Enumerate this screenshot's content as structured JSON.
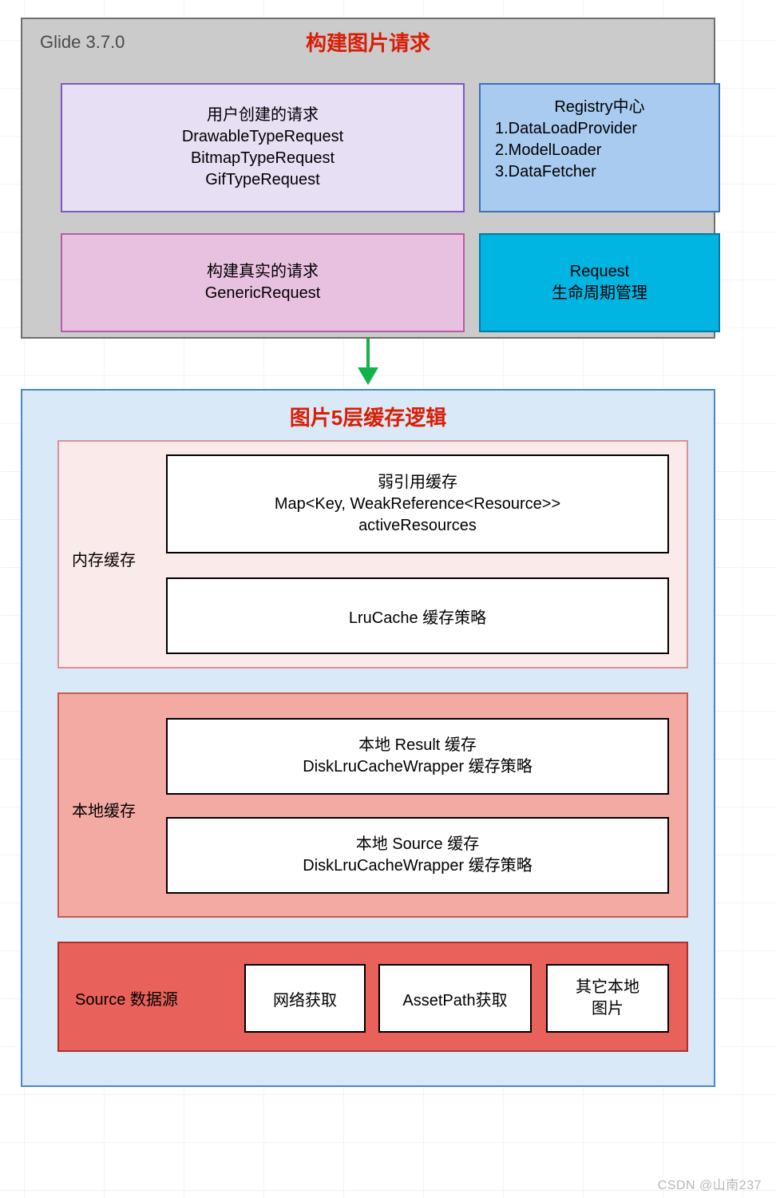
{
  "section1": {
    "label": "Glide 3.7.0",
    "title": "构建图片请求",
    "userRequest": {
      "line1": "用户创建的请求",
      "line2": "DrawableTypeRequest",
      "line3": "BitmapTypeRequest",
      "line4": "GifTypeRequest"
    },
    "registry": {
      "title": "Registry中心",
      "item1": "1.DataLoadProvider",
      "item2": "2.ModelLoader",
      "item3": "3.DataFetcher"
    },
    "generic": {
      "line1": "构建真实的请求",
      "line2": "GenericRequest"
    },
    "lifecycle": {
      "line1": "Request",
      "line2": "生命周期管理"
    }
  },
  "section2": {
    "title": "图片5层缓存逻辑",
    "memory": {
      "label": "内存缓存",
      "weak": {
        "line1": "弱引用缓存",
        "line2": "Map<Key, WeakReference<Resource>>",
        "line3": "activeResources"
      },
      "lru": "LruCache 缓存策略"
    },
    "disk": {
      "label": "本地缓存",
      "result": {
        "line1": "本地 Result 缓存",
        "line2": "DiskLruCacheWrapper 缓存策略"
      },
      "source": {
        "line1": "本地 Source 缓存",
        "line2": "DiskLruCacheWrapper 缓存策略"
      }
    },
    "source": {
      "label": "Source 数据源",
      "net": "网络获取",
      "asset": "AssetPath获取",
      "other": {
        "line1": "其它本地",
        "line2": "图片"
      }
    }
  },
  "watermark": "CSDN @山南237"
}
